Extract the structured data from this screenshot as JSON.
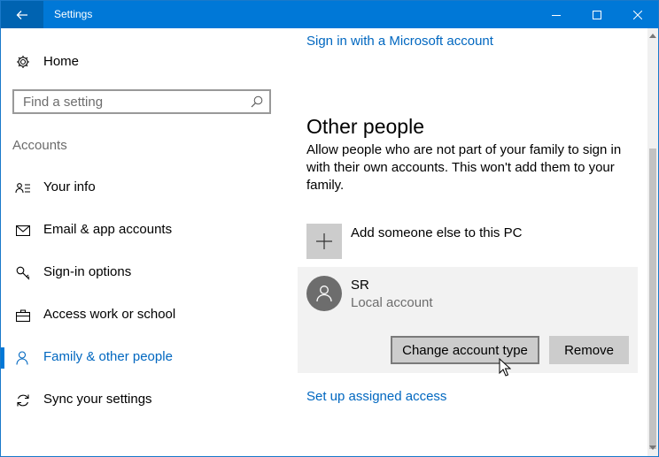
{
  "window": {
    "title": "Settings"
  },
  "sidebar": {
    "home_label": "Home",
    "search": {
      "placeholder": "Find a setting"
    },
    "section_heading": "Accounts",
    "items": [
      {
        "label": "Your info",
        "icon": "person-card-icon"
      },
      {
        "label": "Email & app accounts",
        "icon": "mail-icon"
      },
      {
        "label": "Sign-in options",
        "icon": "key-icon"
      },
      {
        "label": "Access work or school",
        "icon": "briefcase-icon"
      },
      {
        "label": "Family & other people",
        "icon": "person-icon",
        "selected": true
      },
      {
        "label": "Sync your settings",
        "icon": "sync-icon"
      }
    ]
  },
  "main": {
    "signin_link": "Sign in with a Microsoft account",
    "heading": "Other people",
    "description": "Allow people who are not part of your family to sign in with their own accounts. This won't add them to your family.",
    "add_label": "Add someone else to this PC",
    "account": {
      "name": "SR",
      "type": "Local account",
      "change_button": "Change account type",
      "remove_button": "Remove"
    },
    "assigned_access_link": "Set up assigned access"
  },
  "colors": {
    "accent": "#0078d7",
    "link": "#0067c0",
    "titlebar": "#0078d7"
  }
}
